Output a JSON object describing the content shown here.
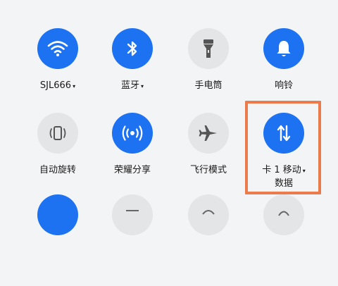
{
  "tiles": [
    {
      "label": "SJL666",
      "dropdown": true,
      "state": "on",
      "icon": "wifi-icon"
    },
    {
      "label": "蓝牙",
      "dropdown": true,
      "state": "on",
      "icon": "bluetooth-icon"
    },
    {
      "label": "手电筒",
      "dropdown": false,
      "state": "off",
      "icon": "flashlight-icon"
    },
    {
      "label": "响铃",
      "dropdown": false,
      "state": "on",
      "icon": "bell-icon"
    },
    {
      "label": "自动旋转",
      "dropdown": false,
      "state": "off",
      "icon": "auto-rotate-icon"
    },
    {
      "label": "荣耀分享",
      "dropdown": false,
      "state": "on",
      "icon": "honor-share-icon"
    },
    {
      "label": "飞行模式",
      "dropdown": false,
      "state": "off",
      "icon": "airplane-icon"
    },
    {
      "label": "卡 1 移动",
      "sublabel": "数据",
      "dropdown": true,
      "state": "on",
      "icon": "mobile-data-icon"
    }
  ],
  "colors": {
    "active": "#1d72f2",
    "inactive": "#e4e5e7",
    "highlight": "#ec7b4c"
  },
  "caret_glyph": "▾"
}
